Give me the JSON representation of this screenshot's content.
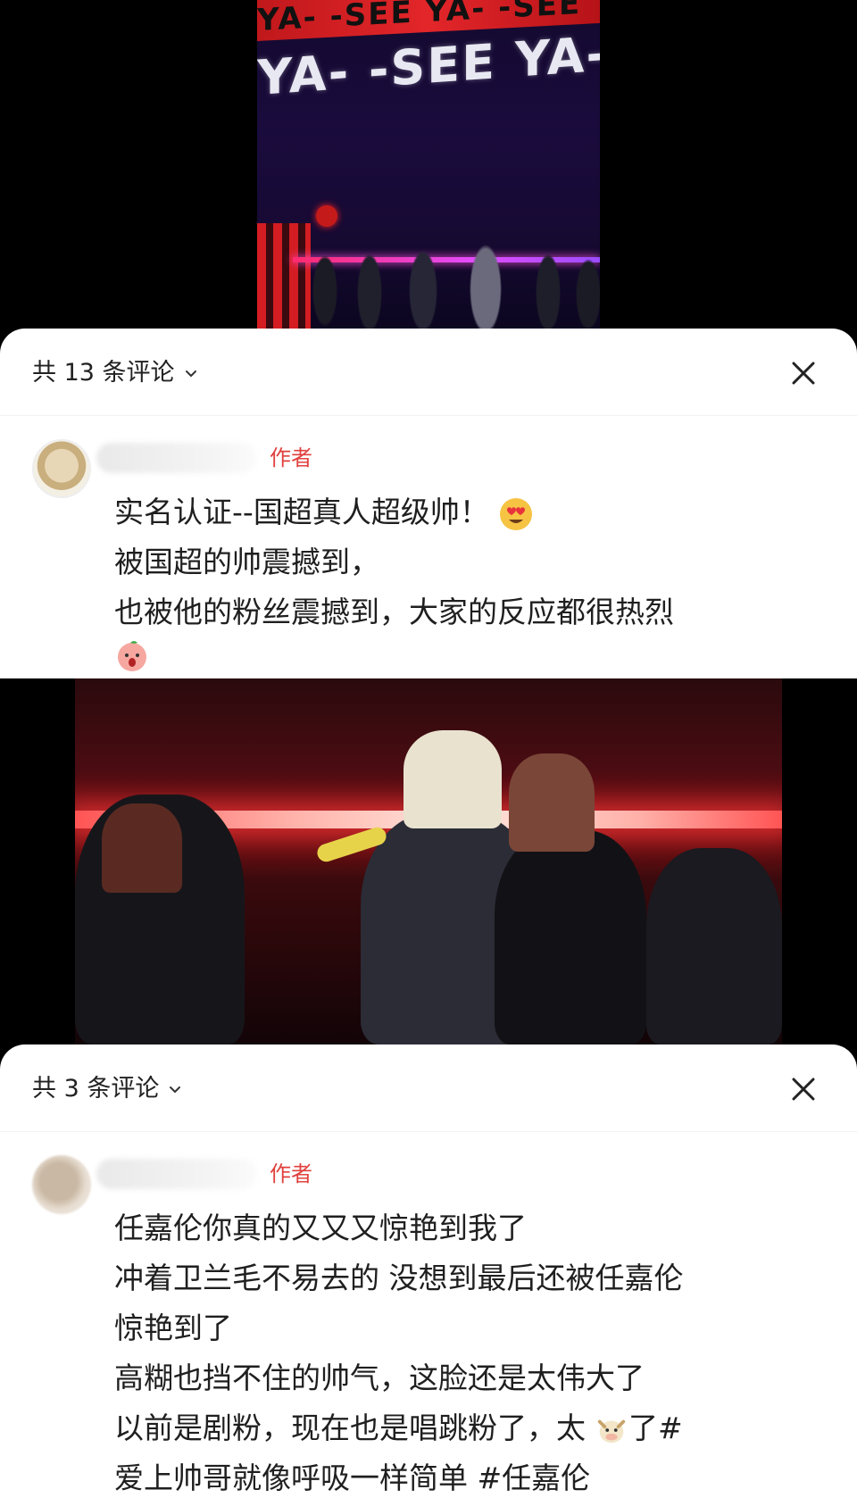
{
  "photo1": {
    "band_text": "YA- -SEE YA- -SEE",
    "screen_text": "YA- -SEE YA-"
  },
  "sheet1": {
    "title": "共 13 条评论",
    "author_badge": "作者",
    "comment_lines": [
      "实名认证--国超真人超级帅！",
      "被国超的帅震撼到，",
      "也被他的粉丝震撼到，大家的反应都很热烈"
    ],
    "icons": [
      "chevron-down-icon",
      "close-icon",
      "heart-eyes-emoji-icon",
      "shocked-peach-emoji-icon"
    ]
  },
  "sheet2": {
    "title": "共 3 条评论",
    "author_badge": "作者",
    "comment_lines": [
      "任嘉伦你真的又又又惊艳到我了",
      "冲着卫兰毛不易去的 没想到最后还被任嘉伦",
      "惊艳到了",
      "高糊也挡不住的帅气，这脸还是太伟大了",
      "以前是剧粉，现在也是唱跳粉了，太",
      "了#",
      "爱上帅哥就像呼吸一样简单 #任嘉伦"
    ],
    "icons": [
      "chevron-down-icon",
      "close-icon",
      "cow-emoji-icon"
    ]
  },
  "colors": {
    "author_badge": "#e0413e",
    "sheet_bg": "#ffffff",
    "page_bg": "#000000"
  }
}
